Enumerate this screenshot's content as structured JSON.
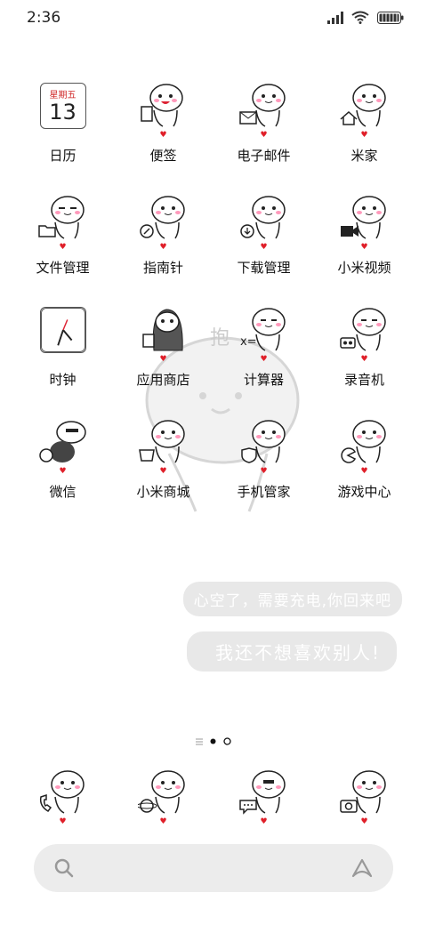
{
  "status_bar": {
    "time": "2:36",
    "signal_icon": "signal-icon",
    "wifi_icon": "wifi-icon",
    "battery_icon": "battery-icon"
  },
  "apps": [
    {
      "label": "日历",
      "icon": "calendar-icon",
      "weekday": "星期五",
      "day": "13"
    },
    {
      "label": "便签",
      "icon": "notes-icon"
    },
    {
      "label": "电子邮件",
      "icon": "mail-icon"
    },
    {
      "label": "米家",
      "icon": "home-icon"
    },
    {
      "label": "文件管理",
      "icon": "folder-icon"
    },
    {
      "label": "指南针",
      "icon": "compass-icon"
    },
    {
      "label": "下载管理",
      "icon": "download-icon"
    },
    {
      "label": "小米视频",
      "icon": "video-icon"
    },
    {
      "label": "时钟",
      "icon": "clock-icon"
    },
    {
      "label": "应用商店",
      "icon": "store-icon"
    },
    {
      "label": "计算器",
      "icon": "calculator-icon"
    },
    {
      "label": "录音机",
      "icon": "recorder-icon"
    },
    {
      "label": "微信",
      "icon": "wechat-icon"
    },
    {
      "label": "小米商城",
      "icon": "shop-icon"
    },
    {
      "label": "手机管家",
      "icon": "security-icon"
    },
    {
      "label": "游戏中心",
      "icon": "game-icon"
    }
  ],
  "watermark_text": "抱",
  "bubbles": {
    "line1": "心空了，需要充电,你回来吧",
    "line2": "我还不想喜欢别人!"
  },
  "pager": {
    "pages": 2,
    "current": 1
  },
  "dock": [
    {
      "icon": "phone-icon"
    },
    {
      "icon": "browser-icon"
    },
    {
      "icon": "messages-icon"
    },
    {
      "icon": "camera-icon"
    }
  ],
  "search_bar": {
    "search_icon": "search-icon",
    "assistant_icon": "assistant-icon"
  },
  "colors": {
    "heart": "#e0202a",
    "bubble": "#e8e8e8",
    "search_bg": "#ececec"
  }
}
